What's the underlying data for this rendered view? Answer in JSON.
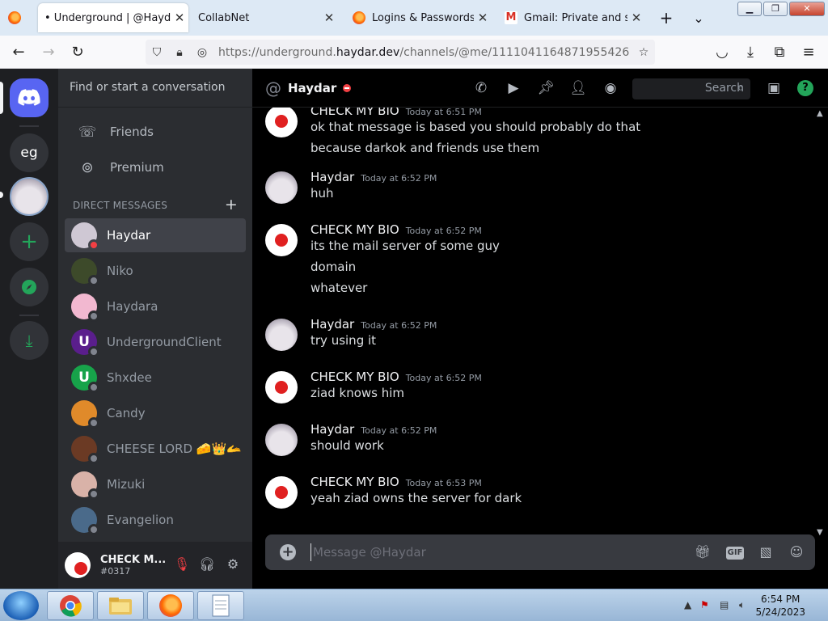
{
  "browser": {
    "tabs": [
      {
        "title": "• Underground | @Haydar",
        "active": true,
        "icon": "firefox-icon"
      },
      {
        "title": "CollabNet",
        "active": false
      },
      {
        "title": "Logins & Passwords",
        "active": false,
        "icon": "firefox-icon"
      },
      {
        "title": "Gmail: Private and secure",
        "active": false,
        "icon": "gmail-icon"
      }
    ],
    "new_tab": "+",
    "list_tabs": "⌄",
    "url_host_prefix": "https://underground.",
    "url_host": "haydar.dev",
    "url_path": "/channels/@me/1111041164871955426"
  },
  "discord": {
    "servers": [
      "home-discord",
      "eg",
      "anime-avatar-server",
      "add-server",
      "explore",
      "download"
    ],
    "server_eg_label": "eg",
    "search_placeholder": "Find or start a conversation",
    "nav": {
      "friends": "Friends",
      "premium": "Premium"
    },
    "dm_header": "DIRECT MESSAGES",
    "dms": [
      {
        "name": "Haydar",
        "selected": true,
        "status": "dnd",
        "avatar_color": "#cfc8d4"
      },
      {
        "name": "Niko",
        "status": "offline",
        "avatar_color": "#3d4a2a"
      },
      {
        "name": "Haydara",
        "status": "offline",
        "avatar_color": "#f2b8d0"
      },
      {
        "name": "UndergroundClient",
        "status": "offline",
        "avatar_color": "#5a1e8c",
        "letter": "U"
      },
      {
        "name": "Shxdee",
        "status": "offline",
        "avatar_color": "#17a34a",
        "letter": "U"
      },
      {
        "name": "Candy",
        "status": "offline",
        "avatar_color": "#e08a2a"
      },
      {
        "name": "CHEESE LORD 🧀👑🫴",
        "status": "offline",
        "avatar_color": "#6b3a24"
      },
      {
        "name": "Mizuki",
        "status": "offline",
        "avatar_color": "#d9b2a8"
      },
      {
        "name": "Evangelion",
        "status": "offline",
        "avatar_color": "#4a6a8a"
      }
    ],
    "user": {
      "name": "CHECK M...",
      "tag": "#0317"
    },
    "chat": {
      "recipient": "Haydar",
      "search_label": "Search",
      "composer_placeholder": "Message @Haydar",
      "messages": [
        {
          "author": "CHECK MY BIO",
          "time": "Today at 6:51 PM",
          "avatar": "apple",
          "lines": [
            "ok that message is based you should probably do that",
            "because darkok and friends use them"
          ]
        },
        {
          "author": "Haydar",
          "time": "Today at 6:52 PM",
          "avatar": "anime",
          "lines": [
            "huh"
          ]
        },
        {
          "author": "CHECK MY BIO",
          "time": "Today at 6:52 PM",
          "avatar": "apple",
          "lines": [
            "its the mail server of some guy",
            "domain",
            "whatever"
          ]
        },
        {
          "author": "Haydar",
          "time": "Today at 6:52 PM",
          "avatar": "anime",
          "lines": [
            "try using it"
          ]
        },
        {
          "author": "CHECK MY BIO",
          "time": "Today at 6:52 PM",
          "avatar": "apple",
          "lines": [
            "ziad knows him"
          ]
        },
        {
          "author": "Haydar",
          "time": "Today at 6:52 PM",
          "avatar": "anime",
          "lines": [
            "should work"
          ]
        },
        {
          "author": "CHECK MY BIO",
          "time": "Today at 6:53 PM",
          "avatar": "apple",
          "lines": [
            "yeah ziad owns the server for dark"
          ]
        }
      ]
    }
  },
  "taskbar": {
    "clock_time": "6:54 PM",
    "clock_date": "5/24/2023",
    "apps": [
      "chrome",
      "file-explorer",
      "firefox",
      "notepad"
    ]
  },
  "colors": {
    "blurple": "#5865f2",
    "green": "#23a55a",
    "dnd": "#f23f43",
    "bg": "#000000"
  }
}
